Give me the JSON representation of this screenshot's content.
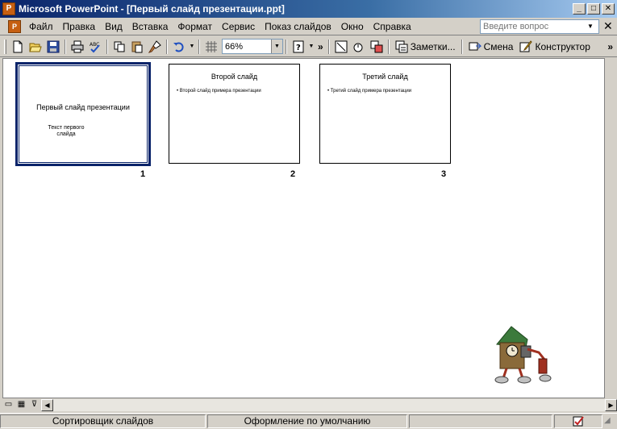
{
  "window": {
    "title": "Microsoft PowerPoint - [Первый слайд презентации.ppt]",
    "app_icon": "powerpoint-icon",
    "minimize": "_",
    "maximize": "□",
    "close": "✕"
  },
  "menubar": {
    "items": [
      "Файл",
      "Правка",
      "Вид",
      "Вставка",
      "Формат",
      "Сервис",
      "Показ слайдов",
      "Окно",
      "Справка"
    ],
    "ask_placeholder": "Введите вопрос",
    "doc_close": "✕"
  },
  "toolbar": {
    "zoom_value": "66%",
    "notes_label": "Заметки...",
    "transition_label": "Смена",
    "design_label": "Конструктор",
    "icons": [
      "new-icon",
      "open-icon",
      "save-icon",
      "print-icon",
      "spellcheck-icon",
      "copy-icon",
      "paste-icon",
      "format-painter-icon",
      "undo-icon",
      "grid-icon",
      "help-icon",
      "grayscale-icon",
      "hide-slide-icon",
      "rehearse-icon"
    ]
  },
  "slides": [
    {
      "number": "1",
      "title": "Первый слайд презентации",
      "subtitle_line1": "Текст первого",
      "subtitle_line2": "слайда",
      "selected": true
    },
    {
      "number": "2",
      "title": "Второй слайд",
      "bullet": "Второй слайд примера презентации",
      "selected": false
    },
    {
      "number": "3",
      "title": "Третий слайд",
      "bullet": "Третий слайд примера презентации",
      "selected": false
    }
  ],
  "statusbar": {
    "view": "Сортировщик слайдов",
    "design": "Оформление по умолчанию",
    "spell_icon": "spelling-status-icon"
  },
  "colors": {
    "titlebar_start": "#0a246a",
    "titlebar_end": "#a6caf0",
    "chrome": "#d4d0c8",
    "selection_border": "#0a246a"
  }
}
